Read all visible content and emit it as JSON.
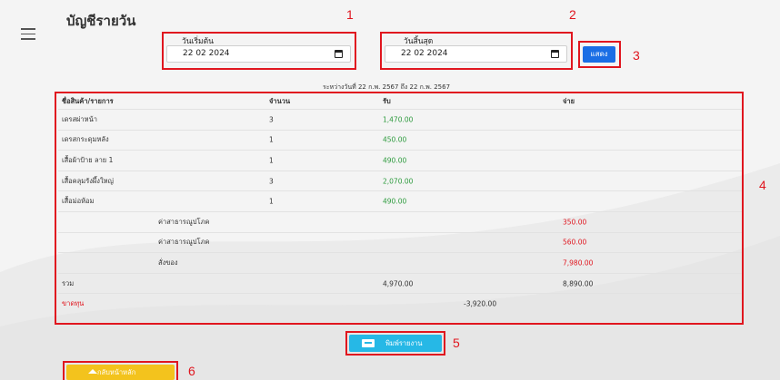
{
  "page_title": "บัญชีรายวัน",
  "start_date": {
    "label": "วันเริ่มต้น",
    "value": "22 02 2024"
  },
  "end_date": {
    "label": "วันสิ้นสุด",
    "value": "22 02 2024"
  },
  "show_button": "แสดง",
  "range_caption": "ระหว่างวันที่ 22 ก.พ. 2567 ถึง 22 ก.พ. 2567",
  "annotations": [
    "1",
    "2",
    "3",
    "4",
    "5",
    "6"
  ],
  "table": {
    "headers": {
      "name": "ชื่อสินค้า/รายการ",
      "qty": "จำนวน",
      "recv": "รับ",
      "pay": "จ่าย"
    },
    "sales": [
      {
        "name": "เดรสผ่าหน้า",
        "qty": "3",
        "recv": "1,470.00"
      },
      {
        "name": "เดรสกระดุมหลัง",
        "qty": "1",
        "recv": "450.00"
      },
      {
        "name": "เสื้อผ้าป้าย ลาย 1",
        "qty": "1",
        "recv": "490.00"
      },
      {
        "name": "เสื้อคลุมรังผึ้งใหญ่",
        "qty": "3",
        "recv": "2,070.00"
      },
      {
        "name": "เสื้อม่อห้อม",
        "qty": "1",
        "recv": "490.00"
      }
    ],
    "expenses": [
      {
        "name": "ค่าสาธารณูปโภค",
        "pay": "350.00"
      },
      {
        "name": "ค่าสาธารณูปโภค",
        "pay": "560.00"
      },
      {
        "name": "สั่งของ",
        "pay": "7,980.00"
      }
    ],
    "total": {
      "label": "รวม",
      "recv": "4,970.00",
      "pay": "8,890.00"
    },
    "net": {
      "label": "ขาดทุน",
      "value": "-3,920.00"
    }
  },
  "print_button": "พิมพ์รายงาน",
  "home_button": "กลับหน้าหลัก",
  "colors": {
    "accent_red": "#e0161f",
    "positive": "#2e9b3e",
    "show_btn": "#1a6ee5",
    "print_btn": "#26b8e6",
    "home_btn": "#f3c31d"
  }
}
